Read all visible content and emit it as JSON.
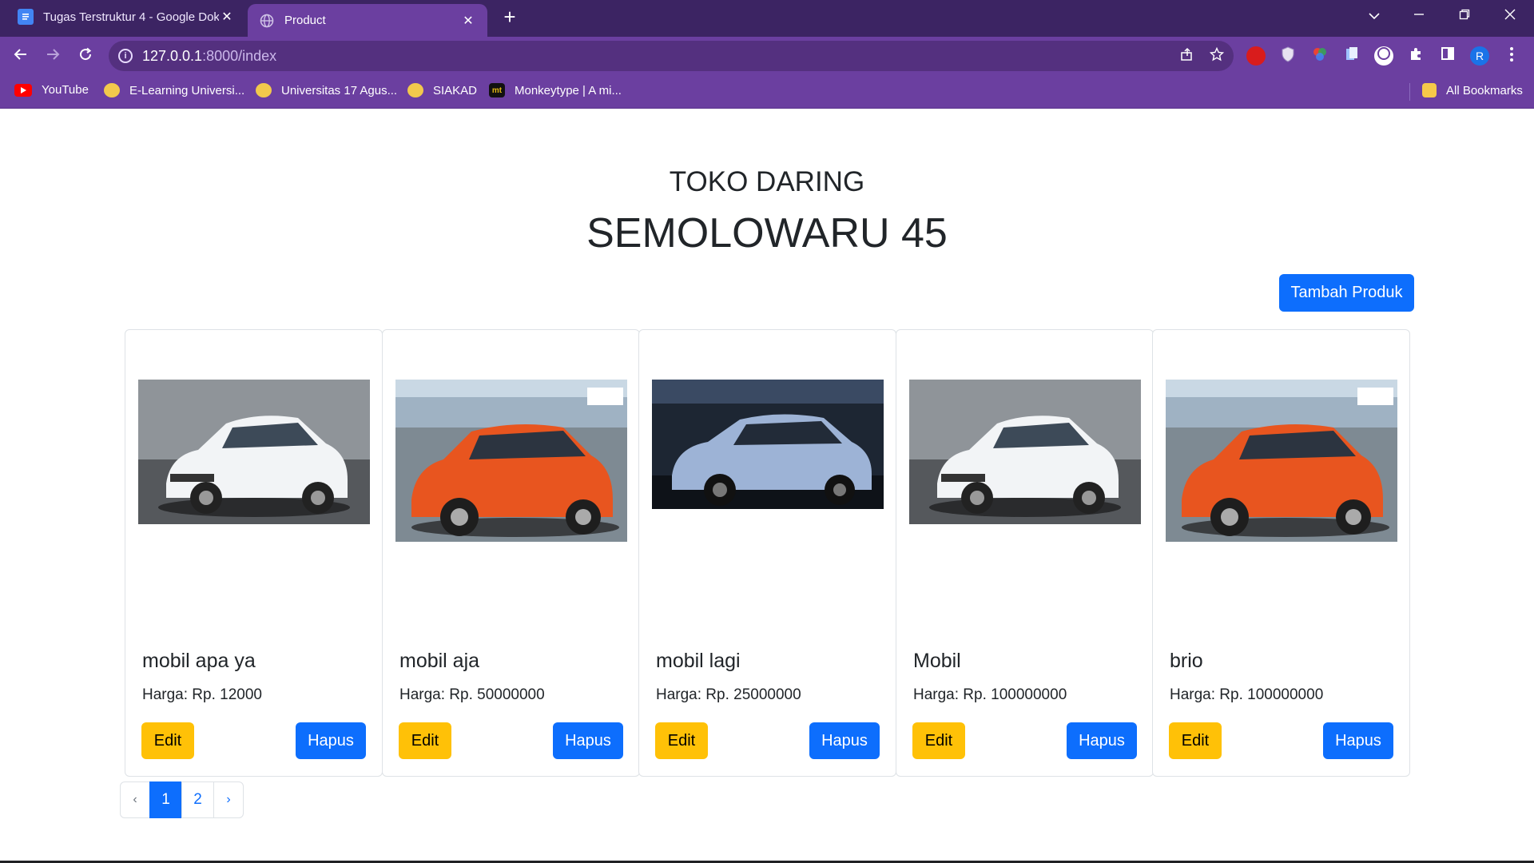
{
  "browser": {
    "tabs": [
      {
        "title": "Tugas Terstruktur 4 - Google Dok",
        "close": "✕",
        "active": false
      },
      {
        "title": "Product",
        "close": "✕",
        "active": true
      }
    ],
    "new_tab": "+",
    "address": {
      "host": "127.0.0.1",
      "rest": ":8000/index"
    },
    "bookmarks": [
      {
        "label": "YouTube"
      },
      {
        "label": "E-Learning Universi..."
      },
      {
        "label": "Universitas 17 Agus..."
      },
      {
        "label": "SIAKAD"
      },
      {
        "label": "Monkeytype | A mi..."
      }
    ],
    "all_bookmarks": "All Bookmarks",
    "profile_initial": "R",
    "monkeytype_icon_text": "mt",
    "colors": {
      "frame": "#3c2463",
      "toolbar": "#6b3fa0"
    }
  },
  "page": {
    "subtitle": "TOKO DARING",
    "title": "SEMOLOWARU 45",
    "add_button": "Tambah Produk",
    "products": [
      {
        "name": "mobil apa ya",
        "price": "Harga: Rp. 12000",
        "edit": "Edit",
        "delete": "Hapus",
        "image": "white-honda-jazz"
      },
      {
        "name": "mobil aja",
        "price": "Harga: Rp. 50000000",
        "edit": "Edit",
        "delete": "Hapus",
        "image": "orange-honda-brio"
      },
      {
        "name": "mobil lagi",
        "price": "Harga: Rp. 25000000",
        "edit": "Edit",
        "delete": "Hapus",
        "image": "blue-honda-city-hatchback"
      },
      {
        "name": "Mobil",
        "price": "Harga: Rp. 100000000",
        "edit": "Edit",
        "delete": "Hapus",
        "image": "white-honda-jazz"
      },
      {
        "name": "brio",
        "price": "Harga: Rp. 100000000",
        "edit": "Edit",
        "delete": "Hapus",
        "image": "orange-honda-brio"
      }
    ],
    "pagination": {
      "prev": "‹",
      "pages": [
        "1",
        "2"
      ],
      "current": "1",
      "next": "›"
    },
    "colors": {
      "primary": "#0d6efd",
      "warning": "#ffc107"
    }
  }
}
